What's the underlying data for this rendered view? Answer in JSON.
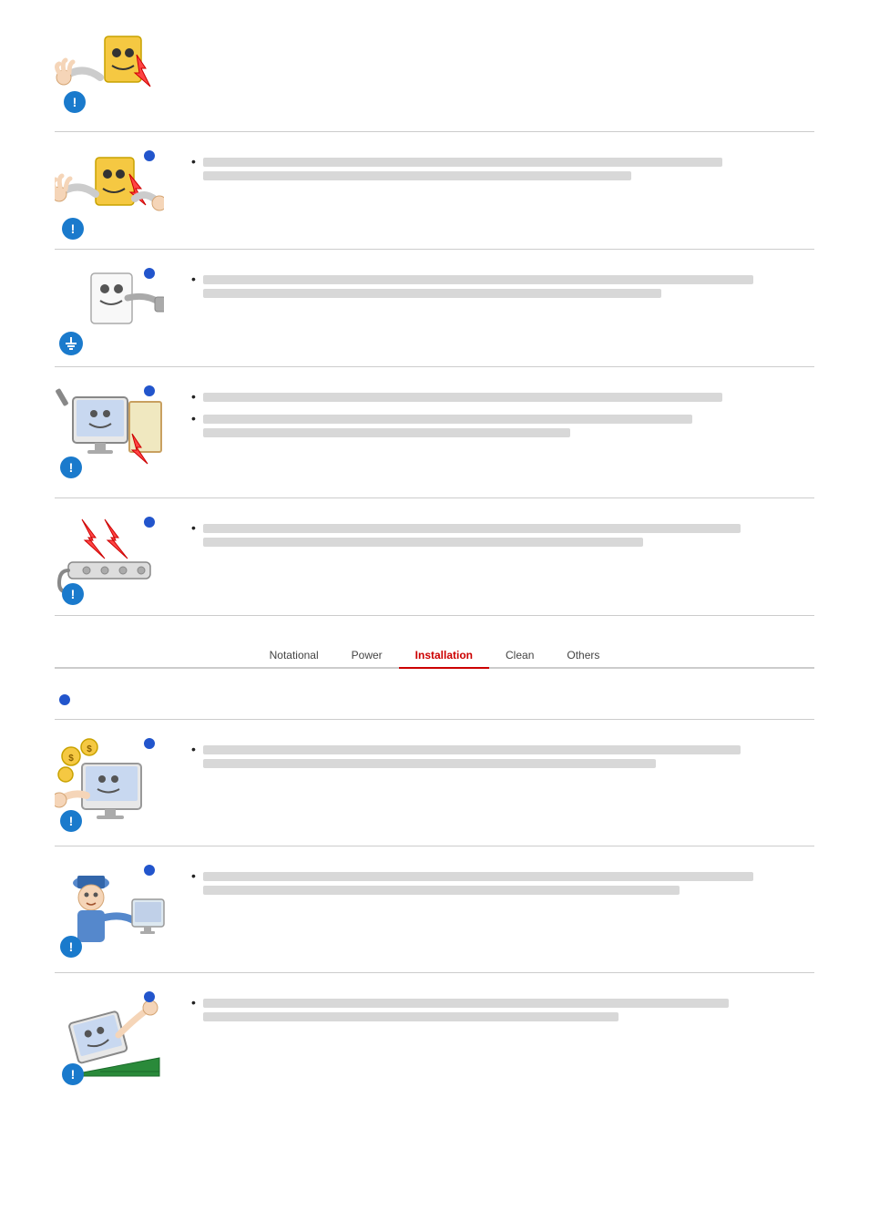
{
  "nav": {
    "items": [
      {
        "label": "Notational",
        "active": false
      },
      {
        "label": "Power",
        "active": false
      },
      {
        "label": "Installation",
        "active": true
      },
      {
        "label": "Clean",
        "active": false
      },
      {
        "label": "Others",
        "active": false
      }
    ]
  },
  "sections_top": [
    {
      "id": "section-1",
      "has_top_circle": false,
      "illustration_type": "electric-warning-1",
      "bullet_lines": []
    },
    {
      "id": "section-2",
      "has_top_circle": true,
      "illustration_type": "electric-warning-2",
      "bullet_lines": [
        1
      ]
    },
    {
      "id": "section-3",
      "has_top_circle": true,
      "illustration_type": "grounding-warning",
      "bullet_lines": [
        1
      ]
    },
    {
      "id": "section-4",
      "has_top_circle": true,
      "illustration_type": "monitor-warning",
      "bullet_lines": [
        1,
        2
      ]
    },
    {
      "id": "section-5",
      "has_top_circle": true,
      "illustration_type": "powerstrip-warning",
      "bullet_lines": [
        1
      ]
    }
  ],
  "sections_bottom": [
    {
      "id": "section-b1",
      "standalone_circle": true,
      "has_top_circle": false,
      "illustration_type": "none",
      "bullet_lines": []
    },
    {
      "id": "section-b2",
      "has_top_circle": true,
      "illustration_type": "coins-monitor",
      "bullet_lines": [
        1
      ]
    },
    {
      "id": "section-b3",
      "has_top_circle": true,
      "illustration_type": "person-monitor",
      "bullet_lines": [
        1
      ]
    },
    {
      "id": "section-b4",
      "has_top_circle": true,
      "illustration_type": "falling-warning",
      "bullet_lines": [
        1
      ]
    }
  ]
}
